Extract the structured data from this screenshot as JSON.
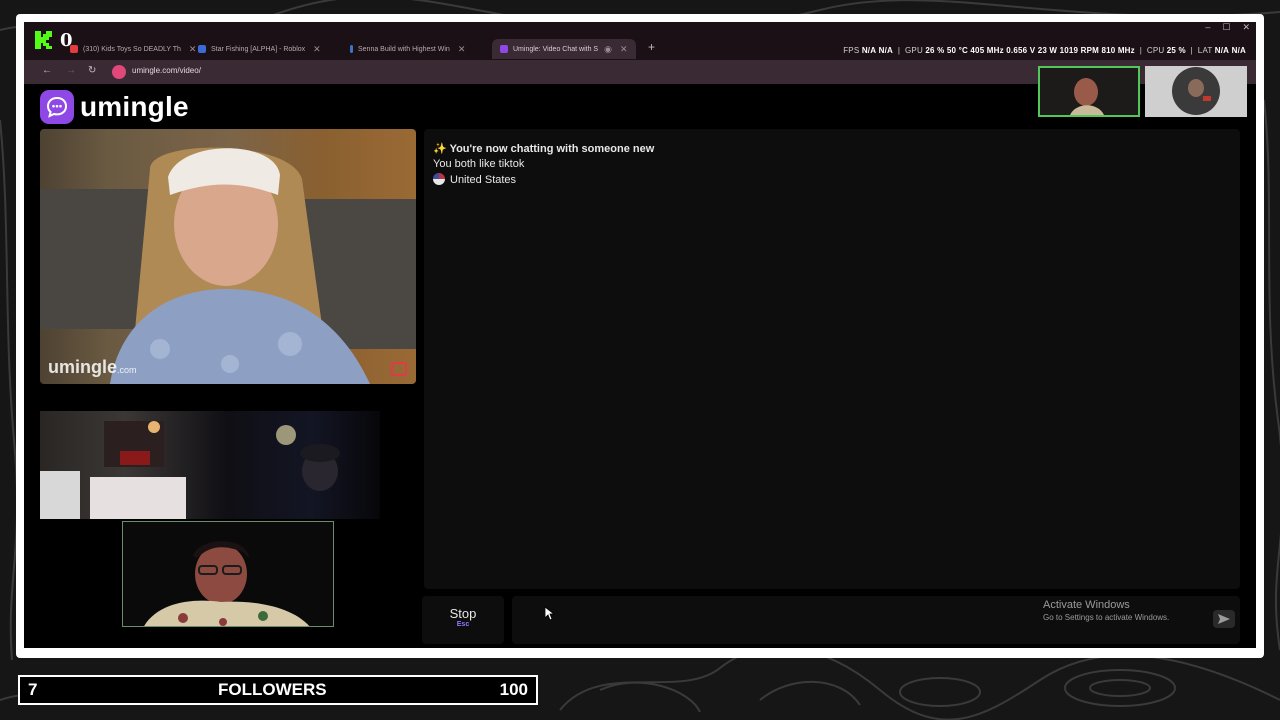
{
  "stream": {
    "kick_count": "0",
    "followers_current": "7",
    "followers_label": "FOLLOWERS",
    "followers_goal": "100"
  },
  "browser": {
    "tabs": [
      {
        "label": "(310) Kids Toys So DEADLY Th",
        "favicon": "youtube-icon",
        "active": false
      },
      {
        "label": "Star Fishing [ALPHA] - Roblox",
        "favicon": "roblox-icon",
        "active": false
      },
      {
        "label": "Senna Build with Highest Win",
        "favicon": "site-icon",
        "active": false
      },
      {
        "label": "Umingle: Video Chat with S",
        "favicon": "umingle-icon",
        "active": true
      }
    ],
    "url": "umingle.com/video/",
    "stats": {
      "fps_label": "FPS",
      "fps_value_1": "N/A",
      "fps_value_2": "N/A",
      "gpu_label": "GPU",
      "gpu_util": "26 %",
      "gpu_temp": "50 °C",
      "gpu_clock": "405 MHz",
      "gpu_volt": "0.656 V",
      "gpu_power": "23 W",
      "gpu_fan": "1019 RPM",
      "gpu_mem": "810 MHz",
      "cpu_label": "CPU",
      "cpu_util": "25 %",
      "lat_label": "LAT",
      "lat_value_1": "N/A",
      "lat_value_2": "N/A"
    }
  },
  "umingle": {
    "logo_text": "umingle",
    "watermark": "umingle",
    "watermark_suffix": ".com",
    "chat": {
      "line1": "You're now chatting with someone new",
      "line2": "You both like tiktok",
      "line3": "United States"
    },
    "stop_label": "Stop",
    "stop_key": "Esc"
  },
  "windows_notice": {
    "title": "Activate Windows",
    "subtitle": "Go to Settings to activate Windows."
  },
  "colors": {
    "accent": "#8e48e6",
    "kick_green": "#53fc18",
    "pip_border": "#52c85a"
  }
}
